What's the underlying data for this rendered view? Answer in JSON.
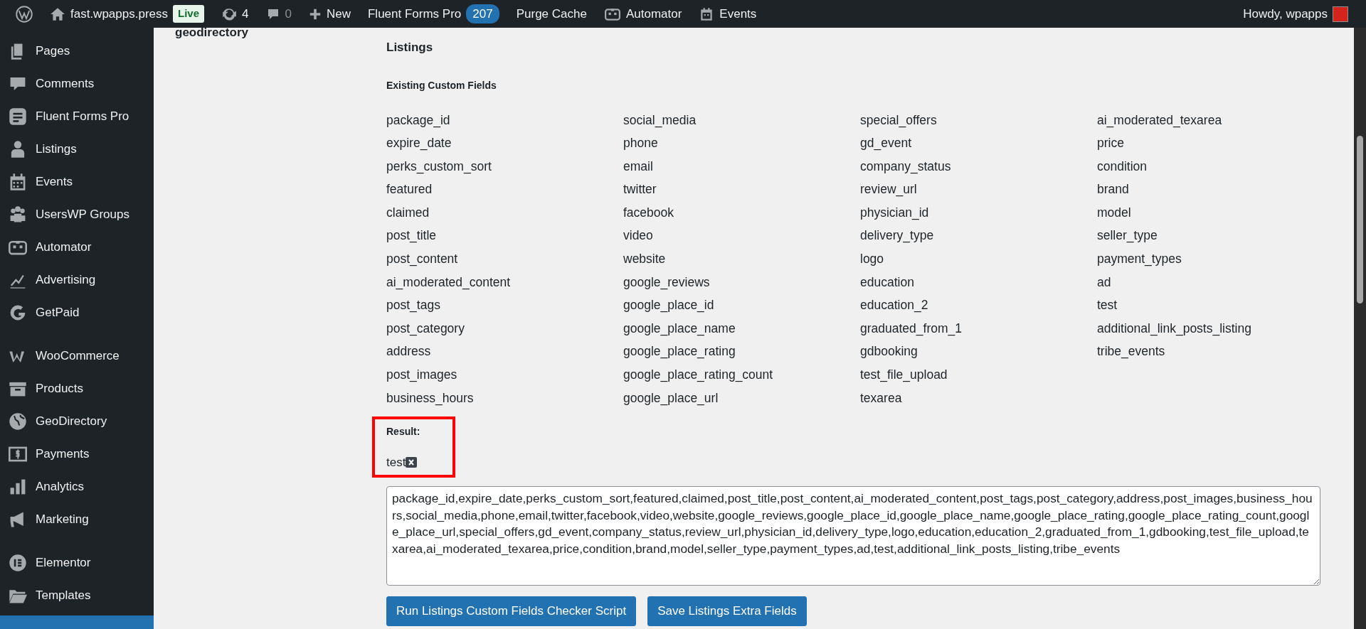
{
  "admin_bar": {
    "site": "fast.wpapps.press",
    "live_badge": "Live",
    "updates": "4",
    "comments": "0",
    "new": "New",
    "fluent_forms": {
      "label": "Fluent Forms Pro",
      "count": "207"
    },
    "purge": "Purge Cache",
    "automator": "Automator",
    "events": "Events",
    "howdy": "Howdy, wpapps"
  },
  "sidebar": {
    "groups": [
      {
        "items": [
          {
            "label": "Pages",
            "kind": "pages"
          },
          {
            "label": "Comments",
            "kind": "comments"
          },
          {
            "label": "Fluent Forms Pro",
            "kind": "forms"
          },
          {
            "label": "Listings",
            "kind": "person"
          },
          {
            "label": "Events",
            "kind": "calendar"
          },
          {
            "label": "UsersWP Groups",
            "kind": "group"
          },
          {
            "label": "Automator",
            "kind": "robot"
          },
          {
            "label": "Advertising",
            "kind": "chart"
          },
          {
            "label": "GetPaid",
            "kind": "getpaid"
          }
        ]
      },
      {
        "items": [
          {
            "label": "WooCommerce",
            "kind": "woo"
          },
          {
            "label": "Products",
            "kind": "archive"
          },
          {
            "label": "GeoDirectory",
            "kind": "globe"
          },
          {
            "label": "Payments",
            "kind": "dollar"
          },
          {
            "label": "Analytics",
            "kind": "bars"
          },
          {
            "label": "Marketing",
            "kind": "megaphone"
          }
        ]
      },
      {
        "items": [
          {
            "label": "Elementor",
            "kind": "elementor"
          },
          {
            "label": "Templates",
            "kind": "folder"
          }
        ]
      }
    ]
  },
  "section_label": "geodirectory",
  "heading": "Listings",
  "subheading": "Existing Custom Fields",
  "fields": [
    [
      "package_id",
      "expire_date",
      "perks_custom_sort",
      "featured",
      "claimed",
      "post_title",
      "post_content",
      "ai_moderated_content",
      "post_tags",
      "post_category",
      "address",
      "post_images",
      "business_hours"
    ],
    [
      "social_media",
      "phone",
      "email",
      "twitter",
      "facebook",
      "video",
      "website",
      "google_reviews",
      "google_place_id",
      "google_place_name",
      "google_place_rating",
      "google_place_rating_count",
      "google_place_url"
    ],
    [
      "special_offers",
      "gd_event",
      "company_status",
      "review_url",
      "physician_id",
      "delivery_type",
      "logo",
      "education",
      "education_2",
      "graduated_from_1",
      "gdbooking",
      "test_file_upload",
      "texarea"
    ],
    [
      "ai_moderated_texarea",
      "price",
      "condition",
      "brand",
      "model",
      "seller_type",
      "payment_types",
      "ad",
      "test",
      "additional_link_posts_listing",
      "tribe_events"
    ]
  ],
  "result": {
    "label": "Result:",
    "items": [
      "test"
    ]
  },
  "textarea": "package_id,expire_date,perks_custom_sort,featured,claimed,post_title,post_content,ai_moderated_content,post_tags,post_category,address,post_images,business_hours,social_media,phone,email,twitter,facebook,video,website,google_reviews,google_place_id,google_place_name,google_place_rating,google_place_rating_count,google_place_url,special_offers,gd_event,company_status,review_url,physician_id,delivery_type,logo,education,education_2,graduated_from_1,gdbooking,test_file_upload,texarea,ai_moderated_texarea,price,condition,brand,model,seller_type,payment_types,ad,test,additional_link_posts_listing,tribe_events",
  "buttons": [
    "Run Listings Custom Fields Checker Script",
    "Save Listings Extra Fields"
  ]
}
